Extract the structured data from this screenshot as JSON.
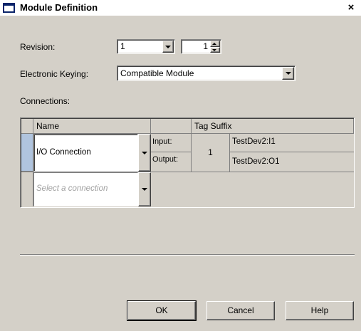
{
  "window": {
    "title": "Module Definition",
    "close_glyph": "×"
  },
  "revision": {
    "label": "Revision:",
    "major": "1",
    "minor": "1"
  },
  "keying": {
    "label": "Electronic Keying:",
    "value": "Compatible Module"
  },
  "connections": {
    "label": "Connections:",
    "headers": {
      "name": "Name",
      "tag_suffix": "Tag Suffix"
    },
    "rows": [
      {
        "name": "I/O Connection",
        "rpi": "1",
        "input_label": "Input:",
        "input_tag": "TestDev2:I1",
        "output_label": "Output:",
        "output_tag": "TestDev2:O1"
      }
    ],
    "new_row_placeholder": "Select a connection"
  },
  "buttons": {
    "ok": "OK",
    "cancel": "Cancel",
    "help": "Help"
  },
  "colors": {
    "face": "#d4d0c8",
    "title_icon": "#0a246a",
    "selection_marker": "#b0c4de"
  },
  "icons": {
    "dropdown": "chevron-down-icon",
    "spin": "spinner-icon",
    "close": "close-icon"
  }
}
